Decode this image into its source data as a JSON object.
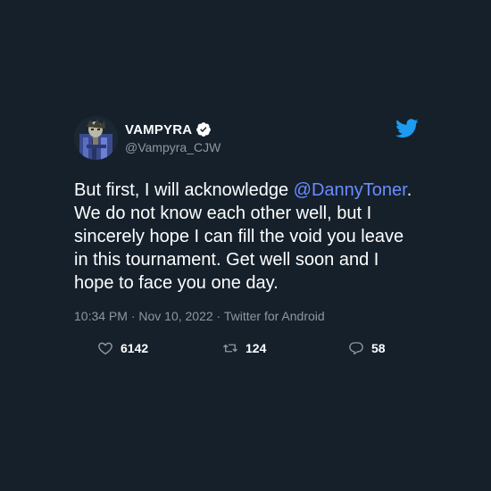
{
  "tweet": {
    "display_name": "VAMPYRA",
    "handle": "@Vampyra_CJW",
    "text_before_mention": "But first, I will acknowledge ",
    "mention": "@DannyToner",
    "text_after_mention": ". We do not know each other well, but I sincerely hope I can fill the void you leave in this tournament. Get well soon and I hope to face you one day.",
    "meta": "10:34 PM · Nov 10, 2022 · Twitter for Android",
    "likes": "6142",
    "retweets": "124",
    "replies": "58"
  },
  "icons": {
    "avatar": "avatar-image",
    "verified": "verified-badge-icon",
    "brand": "twitter-bird-icon",
    "like": "heart-icon",
    "retweet": "retweet-icon",
    "reply": "reply-bubble-icon"
  },
  "colors": {
    "background": "#15202b",
    "mention": "#6b8cff",
    "twitter_blue": "#1d9bf0",
    "secondary_text": "#8b98a5"
  }
}
